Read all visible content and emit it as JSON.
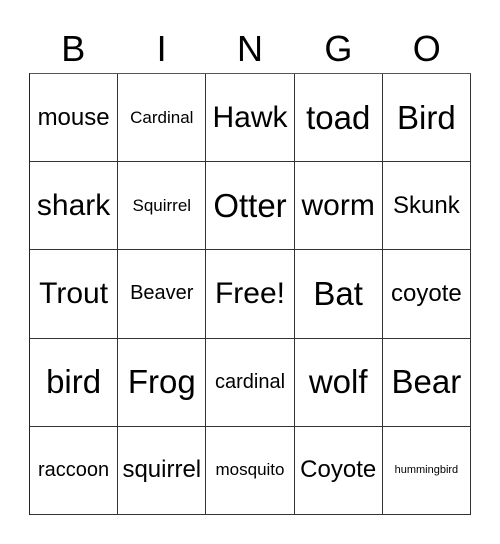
{
  "header": {
    "letters": [
      "B",
      "I",
      "N",
      "G",
      "O"
    ]
  },
  "card": {
    "rows": [
      [
        "mouse",
        "Cardinal",
        "Hawk",
        "toad",
        "Bird"
      ],
      [
        "shark",
        "Squirrel",
        "Otter",
        "worm",
        "Skunk"
      ],
      [
        "Trout",
        "Beaver",
        "Free!",
        "Bat",
        "coyote"
      ],
      [
        "bird",
        "Frog",
        "cardinal",
        "wolf",
        "Bear"
      ],
      [
        "raccoon",
        "squirrel",
        "mosquito",
        "Coyote",
        "hummingbird"
      ]
    ]
  }
}
